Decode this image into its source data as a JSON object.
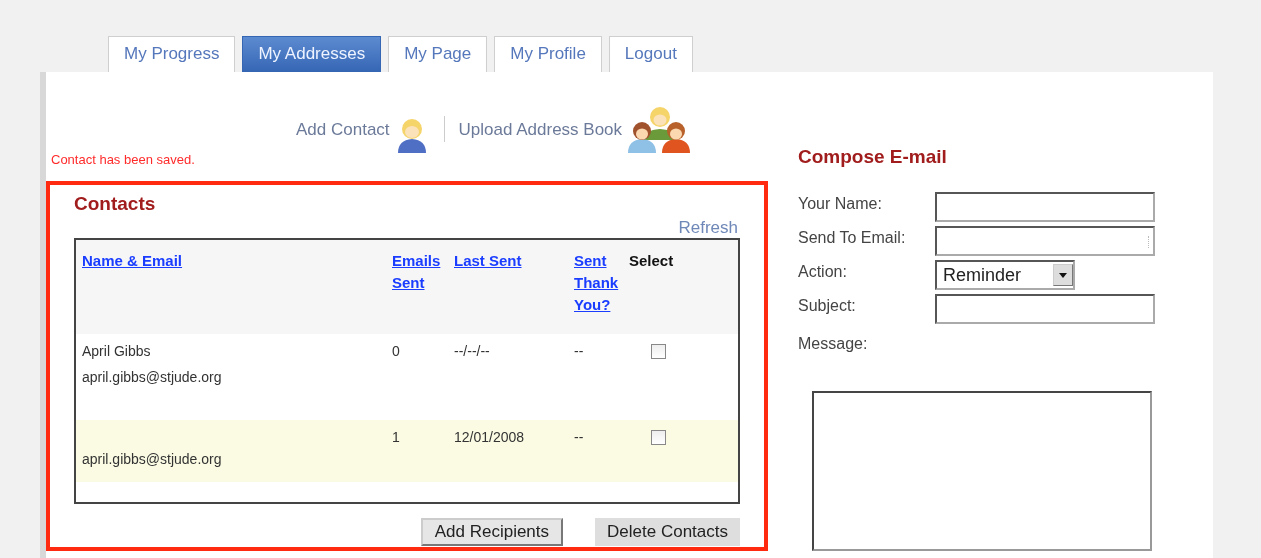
{
  "tabs": [
    {
      "label": "My Progress",
      "selected": false
    },
    {
      "label": "My Addresses",
      "selected": true
    },
    {
      "label": "My Page",
      "selected": false
    },
    {
      "label": "My Profile",
      "selected": false
    },
    {
      "label": "Logout",
      "selected": false
    }
  ],
  "actions": [
    {
      "label": "Add Contact",
      "kind": "single"
    },
    {
      "label": "Upload Address Book",
      "kind": "group"
    }
  ],
  "status_message": "Contact has been saved.",
  "contacts": {
    "title": "Contacts",
    "refresh": "Refresh",
    "columns": [
      {
        "label": "Name & Email",
        "kind": "link"
      },
      {
        "label": "Emails Sent",
        "kind": "link"
      },
      {
        "label": "Last Sent",
        "kind": "link"
      },
      {
        "label": "Sent Thank You?",
        "kind": "link"
      },
      {
        "label": "Select",
        "kind": "plain"
      }
    ],
    "rows": [
      {
        "name": "April Gibbs",
        "email": "april.gibbs@stjude.org",
        "emails_sent": "0",
        "last_sent": "--/--/--",
        "thank_you": "--",
        "checked": false
      },
      {
        "email": "april.gibbs@stjude.org",
        "emails_sent": "1",
        "last_sent": "12/01/2008",
        "thank_you": "--",
        "checked": false
      }
    ],
    "buttons": [
      "Add Recipients",
      "Delete Contacts"
    ]
  },
  "compose": {
    "title": "Compose E-mail",
    "fields": [
      {
        "label": "Your Name:",
        "kind": "text"
      },
      {
        "label": "Send To Email:",
        "kind": "textarea"
      },
      {
        "label": "Action:",
        "kind": "select",
        "value": "Reminder"
      },
      {
        "label": "Subject:",
        "kind": "text"
      }
    ],
    "message_label": "Message:"
  }
}
